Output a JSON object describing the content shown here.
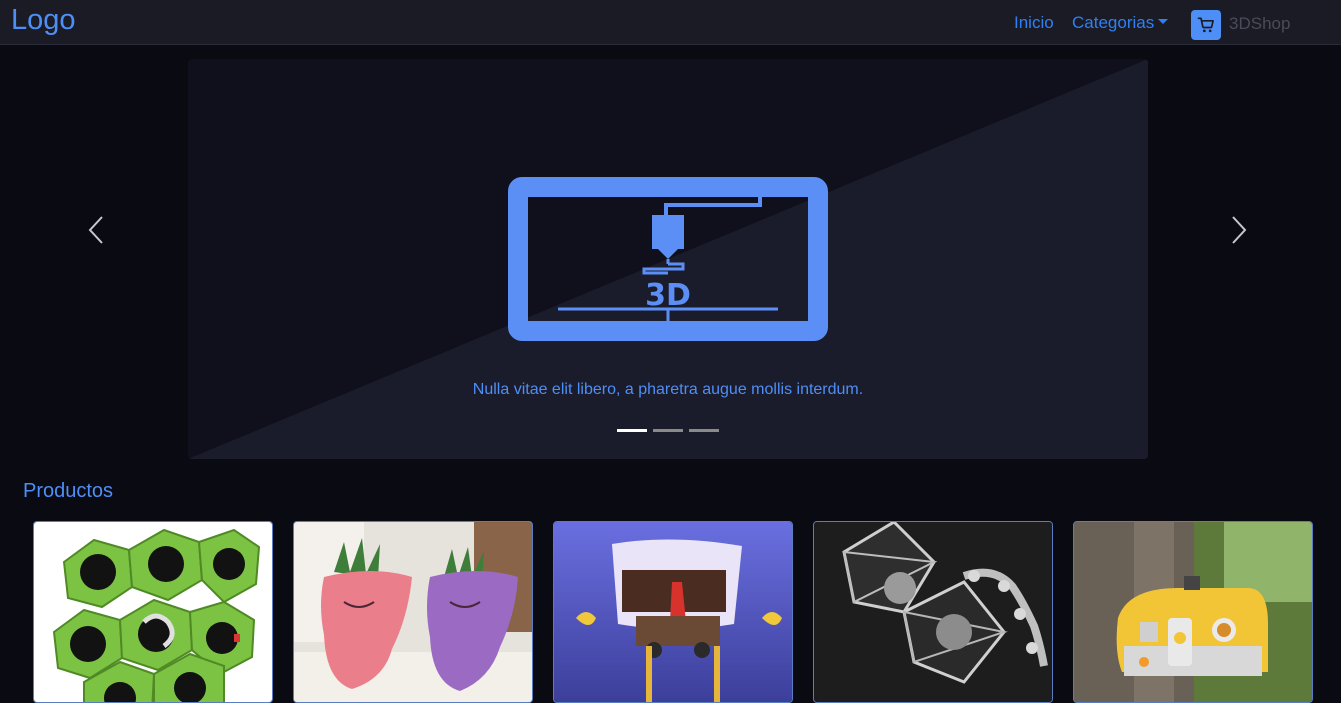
{
  "navbar": {
    "logo": "Logo",
    "links": {
      "inicio": "Inicio",
      "categorias": "Categorias"
    },
    "brand": "3DShop",
    "cart_icon": "shopping-cart-icon"
  },
  "carousel": {
    "caption": "Nulla vitae elit libero, a pharetra augue mollis interdum.",
    "slide_text": "3D",
    "active_slide": 1,
    "slide_count": 3,
    "prev_icon": "chevron-left-icon",
    "next_icon": "chevron-right-icon"
  },
  "products": {
    "title": "Productos",
    "items": [
      {
        "image": "green-hexagon-cable-organizer"
      },
      {
        "image": "face-planter-pots"
      },
      {
        "image": "sponge-character-box"
      },
      {
        "image": "tie-fighter-model"
      },
      {
        "image": "yellow-caravan-birdhouse"
      }
    ]
  },
  "colors": {
    "accent": "#4e8ef7",
    "link": "#2f80f5",
    "navbar_bg": "#1a1b24",
    "page_bg": "#0a0a13"
  }
}
